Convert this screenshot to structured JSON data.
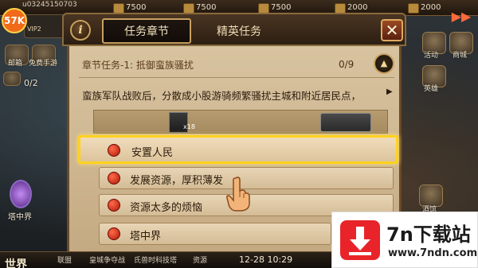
{
  "topbar": {
    "uid": "u03245150703",
    "resources": [
      "7500",
      "7500",
      "7500",
      "2000",
      "2000"
    ]
  },
  "logo": "57K",
  "vip": "VIP2",
  "left_icons": [
    {
      "label": "邮箱",
      "icon": "mail-icon"
    },
    {
      "label": "免费手游",
      "icon": "gift-icon"
    }
  ],
  "left_counter": "0/2",
  "left_orb_label": "塔中界",
  "right_icons": [
    {
      "label": "活动",
      "icon": "event-icon"
    },
    {
      "label": "商城",
      "icon": "shop-icon"
    },
    {
      "label": "英雄",
      "icon": "hero-icon"
    },
    {
      "label": "酒馆",
      "icon": "tavern-icon"
    }
  ],
  "bottombar": {
    "world": "世界",
    "alliance": "联盟",
    "event1": "皇城争夺战",
    "event2": "氏兽时科技塔",
    "clock_prefix": "资源",
    "time": "12-28 10:29"
  },
  "dialog": {
    "info_label": "i",
    "tabs": [
      {
        "label": "任务章节",
        "active": true
      },
      {
        "label": "精英任务",
        "active": false
      }
    ],
    "close_label": "✕",
    "chapter": {
      "title": "章节任务-1: 抵御蛮族骚扰",
      "progress": "0/9"
    },
    "story": "蛮族军队战败后，分散成小股游骑频繁骚扰主城和附近居民点，",
    "reward_count": "x18",
    "quests": [
      {
        "label": "安置人民",
        "highlight": true
      },
      {
        "label": "发展资源，厚积薄发",
        "highlight": false
      },
      {
        "label": "资源太多的烦恼",
        "highlight": false
      },
      {
        "label": "塔中界",
        "highlight": false
      }
    ]
  },
  "watermark": {
    "title": "7n下载站",
    "url": "www.7ndn.com"
  },
  "colors": {
    "highlight_border": "#ffd21e",
    "quest_dot": "#d8281a",
    "close_button": "#9a4a24"
  }
}
